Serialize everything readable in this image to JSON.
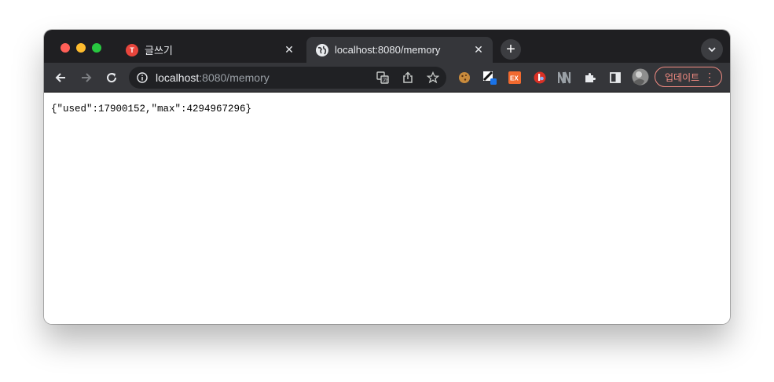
{
  "tabs": [
    {
      "label": "글쓰기",
      "favicon_color": "#e8453c",
      "active": false
    },
    {
      "label": "localhost:8080/memory",
      "active": true
    }
  ],
  "address_bar": {
    "host": "localhost",
    "rest": ":8080/memory"
  },
  "toolbar": {
    "update_label": "업데이트"
  },
  "extensions": [
    "cookie-icon",
    "pencil-ext-icon",
    "ex-ext-icon",
    "red-ext-icon",
    "n-ext-icon",
    "puzzle-icon",
    "sidepanel-icon",
    "profile-avatar"
  ],
  "content": {
    "body_text": "{\"used\":17900152,\"max\":4294967296}"
  },
  "colors": {
    "tabstrip": "#1f1f22",
    "toolbar": "#35363a",
    "accent_update": "#f28b82"
  }
}
